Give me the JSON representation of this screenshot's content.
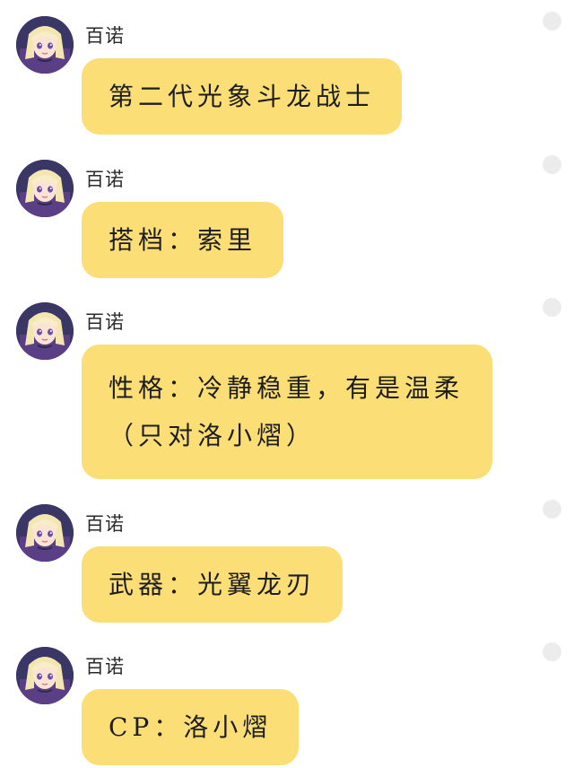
{
  "chat": {
    "messages": [
      {
        "sender": "百诺",
        "text": "第二代光象斗龙战士"
      },
      {
        "sender": "百诺",
        "text": "搭档：索里"
      },
      {
        "sender": "百诺",
        "text": "性格：冷静稳重，有是温柔（只对洛小熠）"
      },
      {
        "sender": "百诺",
        "text": "武器：光翼龙刃"
      },
      {
        "sender": "百诺",
        "text": "CP：洛小熠"
      }
    ]
  },
  "colors": {
    "bubble": "#fcde76",
    "background": "#ffffff",
    "status_dot": "#ececec"
  },
  "icons": {
    "avatar": "character-avatar",
    "status": "status-dot-icon"
  }
}
